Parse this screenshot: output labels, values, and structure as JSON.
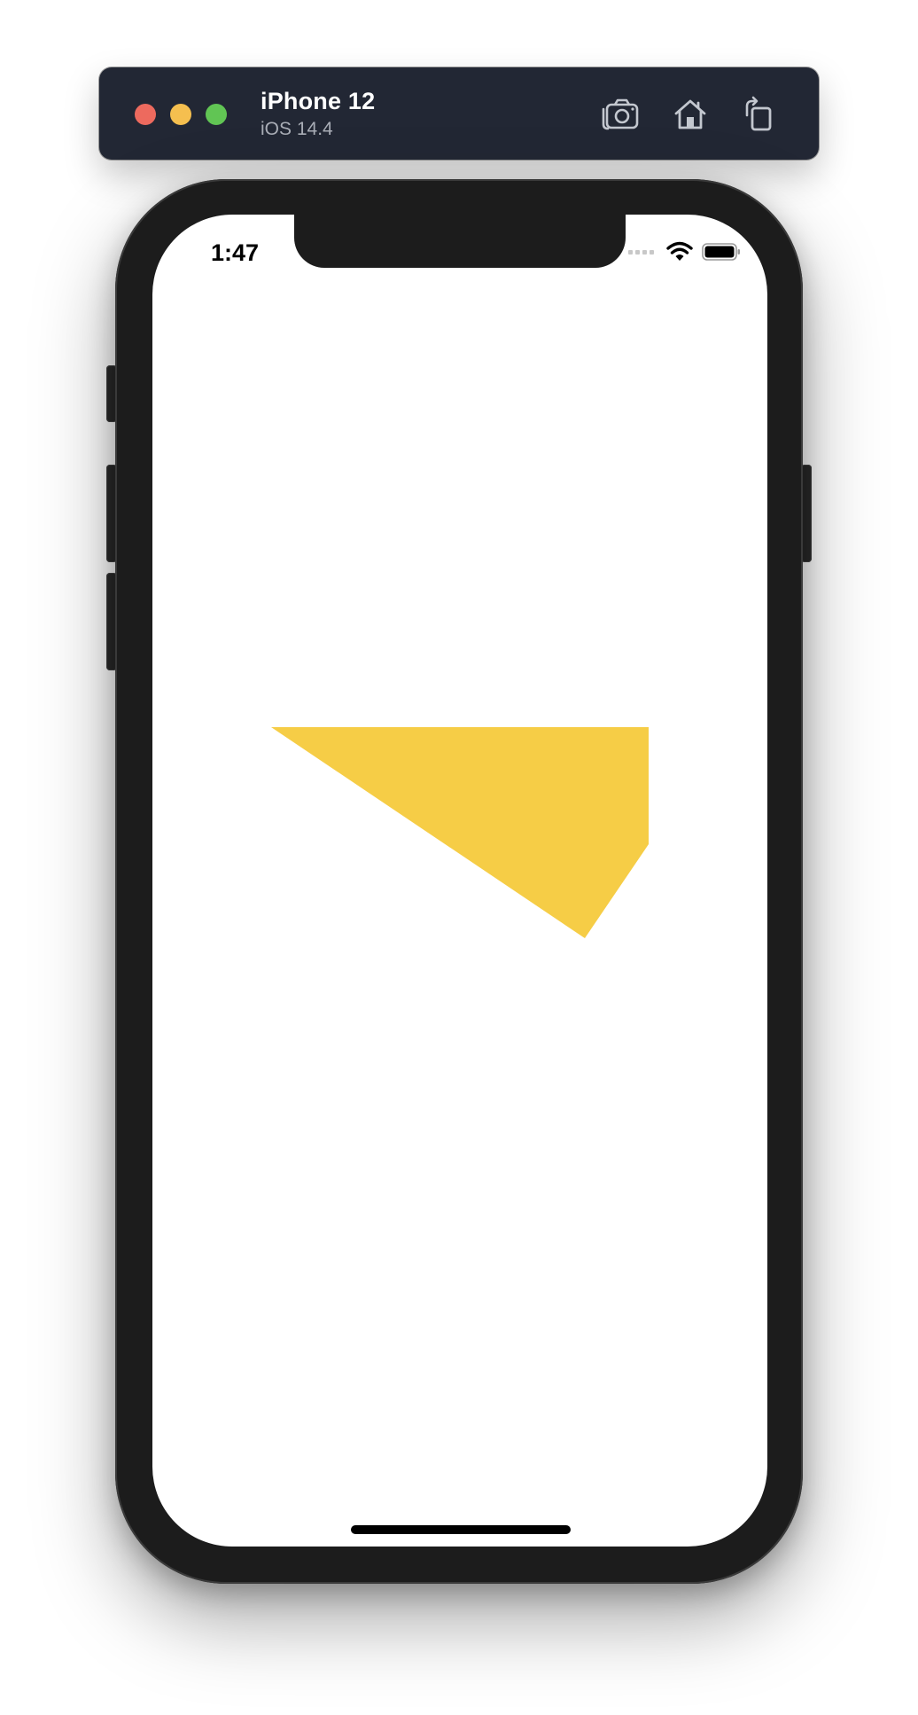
{
  "simulator": {
    "device_name": "iPhone 12",
    "os_version": "iOS 14.4",
    "toolbar": {
      "screenshot_icon": "camera-icon",
      "home_icon": "home-icon",
      "rotate_icon": "rotate-icon"
    },
    "window_controls": [
      "close",
      "minimize",
      "zoom"
    ]
  },
  "status_bar": {
    "time": "1:47",
    "icons": [
      "cellular-signal-icon",
      "wifi-icon",
      "battery-icon"
    ]
  },
  "content": {
    "shape": {
      "type": "polygon",
      "fill": "#F6CD46"
    }
  },
  "colors": {
    "title_bar": "#222734",
    "close": "#ED6A5E",
    "minimize": "#F5BF4F",
    "zoom": "#61C554",
    "phone_frame": "#1C1C1C",
    "screen_background": "#FFFFFF"
  }
}
